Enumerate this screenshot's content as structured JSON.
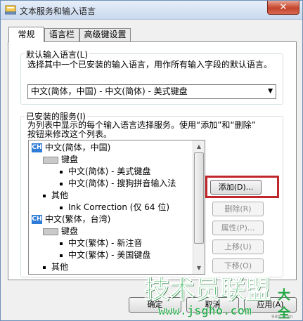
{
  "window": {
    "title": "文本服务和输入语言",
    "close_glyph": "✕"
  },
  "tabs": [
    {
      "label": "常规",
      "active": true
    },
    {
      "label": "语言栏",
      "active": false
    },
    {
      "label": "高级键设置",
      "active": false
    }
  ],
  "default_language": {
    "label": "默认输入语言(L)",
    "description": "选择其中一个已安装的输入语言，用作所有输入字段的默认语言。",
    "selected": "中文(简体，中国) - 中文(简体) - 美式键盘"
  },
  "installed_services": {
    "label": "已安装的服务(I)",
    "description_line1": "为列表中显示的每个输入语言选择服务。使用“添加”和“删除”",
    "description_line2": "按钮来修改这个列表。",
    "tree": [
      {
        "type": "language",
        "badge": "CH",
        "text": "中文(简体，中国)"
      },
      {
        "type": "category",
        "icon": "keyboard-icon",
        "text": "键盘"
      },
      {
        "type": "service",
        "text": "中文(简体) - 美式键盘"
      },
      {
        "type": "service",
        "text": "中文(简体) - 搜狗拼音输入法"
      },
      {
        "type": "category",
        "icon": "bullet",
        "text": "其他"
      },
      {
        "type": "service",
        "text": "Ink Correction (仅 64 位)"
      },
      {
        "type": "language",
        "badge": "CH",
        "text": "中文(繁体，台湾)"
      },
      {
        "type": "category",
        "icon": "keyboard-icon",
        "text": "键盘"
      },
      {
        "type": "service",
        "text": "中文(繁体) - 新注音"
      },
      {
        "type": "service",
        "text": "中文(繁体) - 美国键盘"
      },
      {
        "type": "category",
        "icon": "bullet",
        "text": "其他"
      }
    ]
  },
  "buttons": {
    "add": "添加(D)...",
    "remove": "删除(R)",
    "properties": "属性(P)...",
    "move_up": "上移(U)",
    "move_down": "下移(O)"
  },
  "bottom_buttons": {
    "ok": "确定",
    "cancel": "取消",
    "apply": "应用(A)"
  },
  "watermark": {
    "main": "技术员联盟",
    "side": "大全",
    "url": "www.jsgho.com",
    "small": "985.com"
  }
}
